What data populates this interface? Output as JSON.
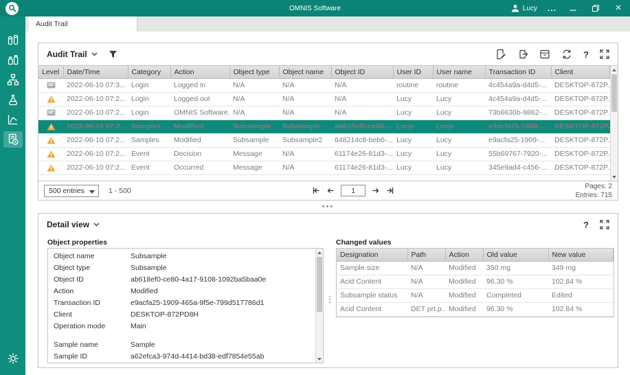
{
  "titlebar": {
    "title": "OMNIS Software",
    "user_name": "Lucy",
    "menu_label": "..."
  },
  "tab": {
    "label": "Audit Trail"
  },
  "splitter_dots": "•••",
  "audit_trail": {
    "title": "Audit Trail",
    "columns": [
      "Level",
      "Date/Time",
      "Category",
      "Action",
      "Object type",
      "Object name",
      "Object ID",
      "User ID",
      "User name",
      "Transaction ID",
      "Client"
    ],
    "rows": [
      {
        "level": "info",
        "datetime": "2022-06-10 07:3...",
        "category": "Login",
        "action": "Logged in",
        "object_type": "N/A",
        "object_name": "N/A",
        "object_id": "N/A",
        "user_id": "routine",
        "user_name": "routine",
        "transaction_id": "4c454a9a-d4d5-...",
        "client": "DESKTOP-872P...",
        "selected": false
      },
      {
        "level": "warning",
        "datetime": "2022-06-10 07:2...",
        "category": "Login",
        "action": "Logged out",
        "object_type": "N/A",
        "object_name": "N/A",
        "object_id": "N/A",
        "user_id": "Lucy",
        "user_name": "Lucy",
        "transaction_id": "4c454a9a-d4d5-...",
        "client": "DESKTOP-872P...",
        "selected": false
      },
      {
        "level": "info",
        "datetime": "2022-06-10 07:2...",
        "category": "Login",
        "action": "OMNIS Software...",
        "object_type": "N/A",
        "object_name": "N/A",
        "object_id": "N/A",
        "user_id": "Lucy",
        "user_name": "Lucy",
        "transaction_id": "73b6630b-9862-...",
        "client": "DESKTOP-872P...",
        "selected": false
      },
      {
        "level": "warning",
        "datetime": "2022-06-10 07:2...",
        "category": "Samples",
        "action": "Modified",
        "object_type": "Subsample",
        "object_name": "Subsample",
        "object_id": "ab618ef0-ce80-...",
        "user_id": "Lucy",
        "user_name": "Lucy",
        "transaction_id": "e9acfa25-1909-...",
        "client": "DESKTOP-872P...",
        "selected": true
      },
      {
        "level": "warning",
        "datetime": "2022-06-10 07:2...",
        "category": "Samples",
        "action": "Modified",
        "object_type": "Subsample",
        "object_name": "Subsample2",
        "object_id": "848214c8-beb6-...",
        "user_id": "Lucy",
        "user_name": "Lucy",
        "transaction_id": "e9acfa25-1909-...",
        "client": "DESKTOP-872P...",
        "selected": false
      },
      {
        "level": "warning",
        "datetime": "2022-06-10 07:2...",
        "category": "Event",
        "action": "Decision",
        "object_type": "Message",
        "object_name": "N/A",
        "object_id": "61174e26-81d3-...",
        "user_id": "Lucy",
        "user_name": "Lucy",
        "transaction_id": "55b69767-7920-...",
        "client": "DESKTOP-872P...",
        "selected": false
      },
      {
        "level": "warning",
        "datetime": "2022-06-10 07:2...",
        "category": "Event",
        "action": "Occurred",
        "object_type": "Message",
        "object_name": "N/A",
        "object_id": "61174e26-81d3-...",
        "user_id": "Lucy",
        "user_name": "Lucy",
        "transaction_id": "345e9ad4-c456-...",
        "client": "DESKTOP-872P...",
        "selected": false
      }
    ],
    "footer": {
      "page_size_label": "500 entries",
      "range_label": "1 - 500",
      "current_page": "1",
      "pages_label": "Pages: 2",
      "entries_label": "Entries: 715"
    }
  },
  "detail_view": {
    "title": "Detail view",
    "object_properties_title": "Object properties",
    "object_properties": [
      {
        "label": "Object name",
        "value": "Subsample"
      },
      {
        "label": "Object type",
        "value": "Subsample"
      },
      {
        "label": "Object ID",
        "value": "ab618ef0-ce80-4a17-9108-1092ba5baa0e"
      },
      {
        "label": "Action",
        "value": "Modified"
      },
      {
        "label": "Transaction ID",
        "value": "e9acfa25-1909-465a-9f5e-799d517786d1"
      },
      {
        "label": "Client",
        "value": "DESKTOP-872PD8H"
      },
      {
        "label": "Operation mode",
        "value": "Main"
      },
      {
        "spacer": true
      },
      {
        "label": "Sample name",
        "value": "Sample"
      },
      {
        "label": "Sample ID",
        "value": "a62efca3-974d-4414-bd38-edf7854e55ab"
      }
    ],
    "changed_values_title": "Changed values",
    "changed_columns": [
      "Designation",
      "Path",
      "Action",
      "Old value",
      "New value"
    ],
    "changed_rows": [
      [
        "Sample size",
        "N/A",
        "Modified",
        "350 mg",
        "349 mg"
      ],
      [
        "Acid Content",
        "N/A",
        "Modified",
        "96.30 %",
        "102.84 %"
      ],
      [
        "Subsample status",
        "N/A",
        "Modified",
        "Completed",
        "Edited"
      ],
      [
        "Acid Content",
        "DET prt.p...",
        "Modified",
        "96.30 %",
        "102.84 %"
      ]
    ]
  }
}
